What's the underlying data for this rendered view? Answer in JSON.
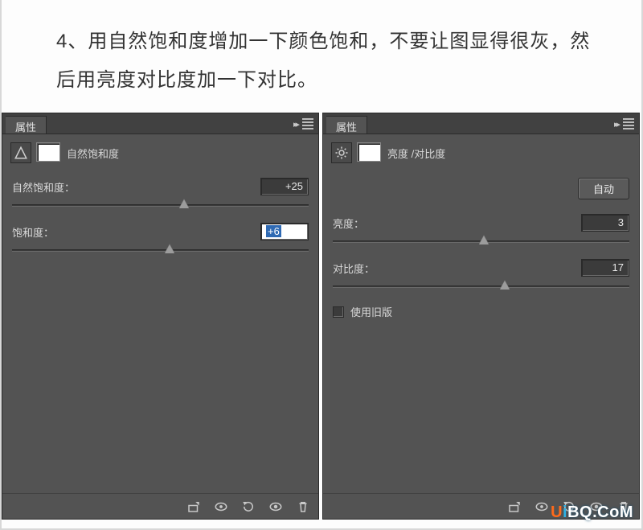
{
  "instruction": "4、用自然饱和度增加一下颜色饱和，不要让图显得很灰，然后用亮度对比度加一下对比。",
  "panels": {
    "vibrance": {
      "tab": "属性",
      "title": "自然饱和度",
      "sliders": {
        "vibrance": {
          "label": "自然饱和度：",
          "value": "+25",
          "pos_pct": 58
        },
        "saturation": {
          "label": "饱和度：",
          "value": "+6",
          "pos_pct": 53,
          "editing": true
        }
      }
    },
    "brightness": {
      "tab": "属性",
      "title": "亮度 /对比度",
      "auto_label": "自动",
      "sliders": {
        "brightness": {
          "label": "亮度：",
          "value": "3",
          "pos_pct": 51
        },
        "contrast": {
          "label": "对比度：",
          "value": "17",
          "pos_pct": 58
        }
      },
      "legacy_label": "使用旧版",
      "legacy_checked": false
    }
  },
  "watermark": "UiBQ.CoM"
}
